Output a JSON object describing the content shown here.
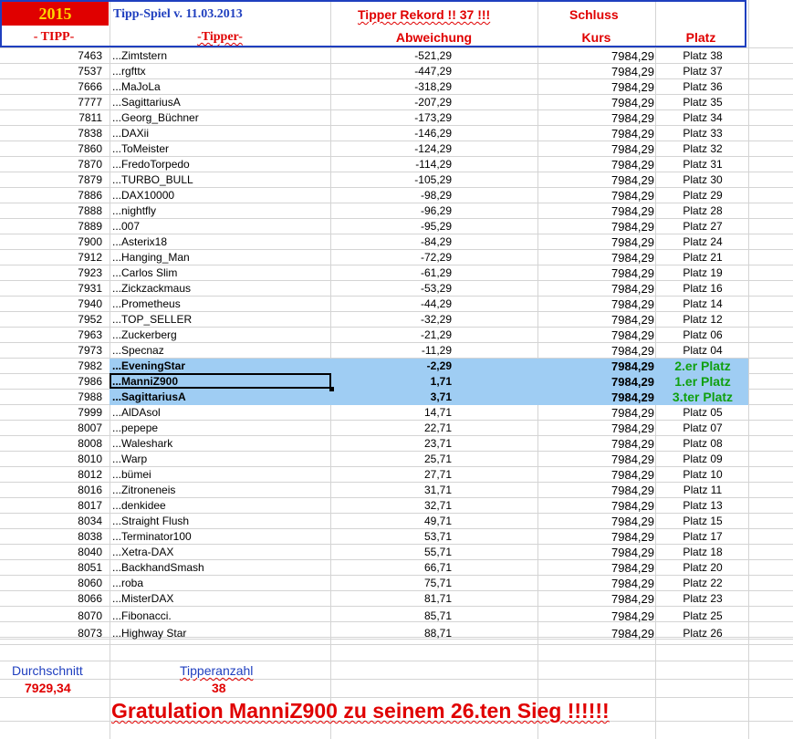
{
  "header": {
    "year": "2015",
    "title": "Tipp-Spiel v. 11.03.2013",
    "rekord": "Tipper Rekord !!  37  !!!",
    "schluss": "Schluss",
    "col_tipp": "- TIPP-",
    "col_tipper": "-Tipper-",
    "col_abweichung": "Abweichung",
    "col_kurs": "Kurs",
    "col_platz": "Platz"
  },
  "rows": [
    {
      "tipp": "7463",
      "name": "...Zimtstern",
      "abw": "-521,29",
      "kurs": "7984,29",
      "platz": "Platz 38"
    },
    {
      "tipp": "7537",
      "name": "...rgfttx",
      "abw": "-447,29",
      "kurs": "7984,29",
      "platz": "Platz 37"
    },
    {
      "tipp": "7666",
      "name": "...MaJoLa",
      "abw": "-318,29",
      "kurs": "7984,29",
      "platz": "Platz 36"
    },
    {
      "tipp": "7777",
      "name": "...SagittariusA",
      "abw": "-207,29",
      "kurs": "7984,29",
      "platz": "Platz 35"
    },
    {
      "tipp": "7811",
      "name": "...Georg_Büchner",
      "abw": "-173,29",
      "kurs": "7984,29",
      "platz": "Platz 34"
    },
    {
      "tipp": "7838",
      "name": "...DAXii",
      "abw": "-146,29",
      "kurs": "7984,29",
      "platz": "Platz 33"
    },
    {
      "tipp": "7860",
      "name": "...ToMeister",
      "abw": "-124,29",
      "kurs": "7984,29",
      "platz": "Platz 32"
    },
    {
      "tipp": "7870",
      "name": "...FredoTorpedo",
      "abw": "-114,29",
      "kurs": "7984,29",
      "platz": "Platz 31"
    },
    {
      "tipp": "7879",
      "name": "...TURBO_BULL",
      "abw": "-105,29",
      "kurs": "7984,29",
      "platz": "Platz 30"
    },
    {
      "tipp": "7886",
      "name": "...DAX10000",
      "abw": "-98,29",
      "kurs": "7984,29",
      "platz": "Platz 29"
    },
    {
      "tipp": "7888",
      "name": "...nightfly",
      "abw": "-96,29",
      "kurs": "7984,29",
      "platz": "Platz 28"
    },
    {
      "tipp": "7889",
      "name": "...007",
      "abw": "-95,29",
      "kurs": "7984,29",
      "platz": "Platz 27"
    },
    {
      "tipp": "7900",
      "name": "...Asterix18",
      "abw": "-84,29",
      "kurs": "7984,29",
      "platz": "Platz 24"
    },
    {
      "tipp": "7912",
      "name": "...Hanging_Man",
      "abw": "-72,29",
      "kurs": "7984,29",
      "platz": "Platz 21"
    },
    {
      "tipp": "7923",
      "name": "...Carlos Slim",
      "abw": "-61,29",
      "kurs": "7984,29",
      "platz": "Platz 19"
    },
    {
      "tipp": "7931",
      "name": "...Zickzackmaus",
      "abw": "-53,29",
      "kurs": "7984,29",
      "platz": "Platz 16"
    },
    {
      "tipp": "7940",
      "name": "...Prometheus",
      "abw": "-44,29",
      "kurs": "7984,29",
      "platz": "Platz 14"
    },
    {
      "tipp": "7952",
      "name": "...TOP_SELLER",
      "abw": "-32,29",
      "kurs": "7984,29",
      "platz": "Platz 12"
    },
    {
      "tipp": "7963",
      "name": "...Zuckerberg",
      "abw": "-21,29",
      "kurs": "7984,29",
      "platz": "Platz 06"
    },
    {
      "tipp": "7973",
      "name": "...Specnaz",
      "abw": "-11,29",
      "kurs": "7984,29",
      "platz": "Platz 04"
    },
    {
      "tipp": "7982",
      "name": "...EveningStar",
      "abw": "-2,29",
      "kurs": "7984,29",
      "platz": "2.er Platz",
      "winner": true
    },
    {
      "tipp": "7986",
      "name": "...ManniZ900",
      "abw": "1,71",
      "kurs": "7984,29",
      "platz": "1.er Platz",
      "winner": true
    },
    {
      "tipp": "7988",
      "name": "...SagittariusA",
      "abw": "3,71",
      "kurs": "7984,29",
      "platz": "3.ter Platz",
      "winner": true
    },
    {
      "tipp": "7999",
      "name": "...AlDAsol",
      "abw": "14,71",
      "kurs": "7984,29",
      "platz": "Platz 05"
    },
    {
      "tipp": "8007",
      "name": "...pepepe",
      "abw": "22,71",
      "kurs": "7984,29",
      "platz": "Platz 07"
    },
    {
      "tipp": "8008",
      "name": "...Waleshark",
      "abw": "23,71",
      "kurs": "7984,29",
      "platz": "Platz 08"
    },
    {
      "tipp": "8010",
      "name": "...Warp",
      "abw": "25,71",
      "kurs": "7984,29",
      "platz": "Platz 09"
    },
    {
      "tipp": "8012",
      "name": "...bümei",
      "abw": "27,71",
      "kurs": "7984,29",
      "platz": "Platz 10"
    },
    {
      "tipp": "8016",
      "name": "...Zitroneneis",
      "abw": "31,71",
      "kurs": "7984,29",
      "platz": "Platz 11"
    },
    {
      "tipp": "8017",
      "name": "...denkidee",
      "abw": "32,71",
      "kurs": "7984,29",
      "platz": "Platz 13"
    },
    {
      "tipp": "8034",
      "name": "...Straight Flush",
      "abw": "49,71",
      "kurs": "7984,29",
      "platz": "Platz 15"
    },
    {
      "tipp": "8038",
      "name": "...Terminator100",
      "abw": "53,71",
      "kurs": "7984,29",
      "platz": "Platz 17"
    },
    {
      "tipp": "8040",
      "name": "...Xetra-DAX",
      "abw": "55,71",
      "kurs": "7984,29",
      "platz": "Platz 18"
    },
    {
      "tipp": "8051",
      "name": "...BackhandSmash",
      "abw": "66,71",
      "kurs": "7984,29",
      "platz": "Platz 20"
    },
    {
      "tipp": "8060",
      "name": "...roba",
      "abw": "75,71",
      "kurs": "7984,29",
      "platz": "Platz 22"
    },
    {
      "tipp": "8066",
      "name": "...MisterDAX",
      "abw": "81,71",
      "kurs": "7984,29",
      "platz": "Platz 23"
    },
    {
      "tipp": "8070",
      "name": "...Fibonacci.",
      "abw": "85,71",
      "kurs": "7984,29",
      "platz": "Platz 25"
    },
    {
      "tipp": "8073",
      "name": "...Highway Star",
      "abw": "88,71",
      "kurs": "7984,29",
      "platz": "Platz 26"
    }
  ],
  "footer": {
    "durchschnitt_label": "Durchschnitt",
    "durchschnitt_value": "7929,34",
    "tipperanzahl_label": "Tipperanzahl",
    "tipperanzahl_value": "38",
    "gratulation": "Gratulation ManniZ900  zu seinem 26.ten Sieg !!!!!!"
  },
  "colors": {
    "header_border": "#1f3fbf",
    "red": "#e00000",
    "highlight": "#9fcdf3",
    "green": "#10a010",
    "year_text": "#ffd400"
  }
}
